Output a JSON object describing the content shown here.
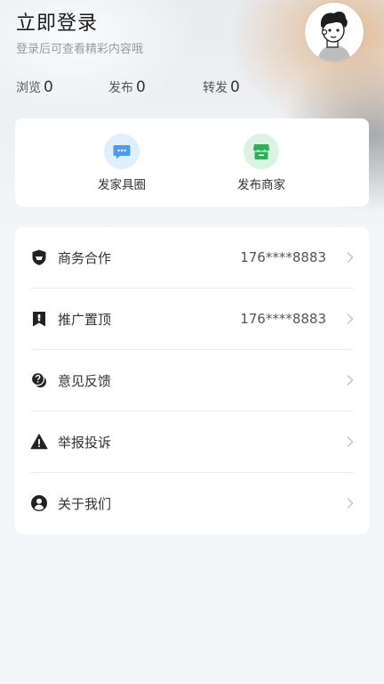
{
  "profile": {
    "title": "立即登录",
    "subtitle": "登录后可查看精彩内容哦"
  },
  "stats": [
    {
      "label": "浏览",
      "value": "0"
    },
    {
      "label": "发布",
      "value": "0"
    },
    {
      "label": "转发",
      "value": "0"
    }
  ],
  "quick_actions": [
    {
      "label": "发家具圈",
      "icon": "chat-bubble-icon",
      "color": "#4a9cf0"
    },
    {
      "label": "发布商家",
      "icon": "shop-icon",
      "color": "#2cb15a"
    }
  ],
  "menu": [
    {
      "label": "商务合作",
      "value": "176****8883",
      "icon": "shield-icon"
    },
    {
      "label": "推广置顶",
      "value": "176****8883",
      "icon": "bookmark-icon"
    },
    {
      "label": "意见反馈",
      "value": "",
      "icon": "feedback-icon"
    },
    {
      "label": "举报投诉",
      "value": "",
      "icon": "warning-icon"
    },
    {
      "label": "关于我们",
      "value": "",
      "icon": "user-icon"
    }
  ]
}
